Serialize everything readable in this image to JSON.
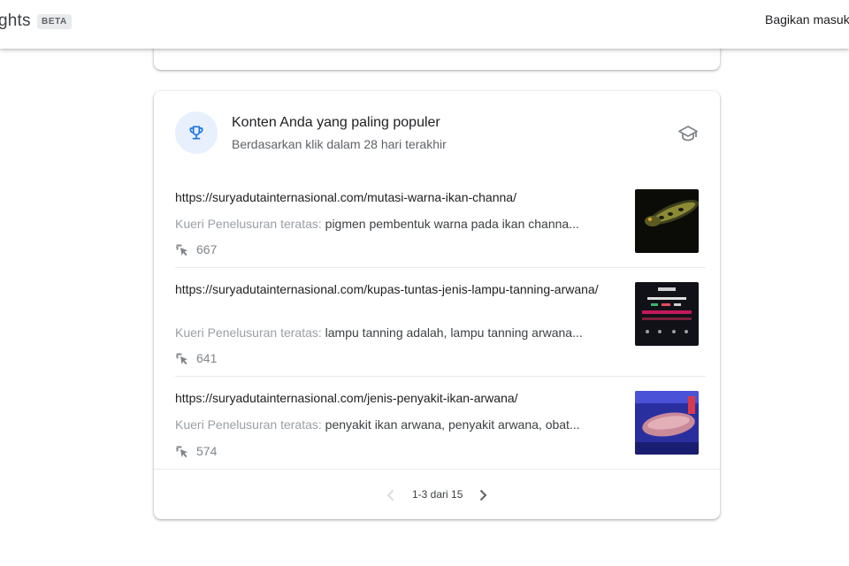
{
  "header": {
    "app_title": "ghts",
    "beta_label": "BETA",
    "feedback_label": "Bagikan masuk"
  },
  "popular_card": {
    "title": "Konten Anda yang paling populer",
    "subtitle": "Berdasarkan klik dalam 28 hari terakhir",
    "icons": {
      "header": "trophy-icon",
      "learn": "school-icon",
      "clicks": "click-icon"
    },
    "items": [
      {
        "url": "https://suryadutainternasional.com/mutasi-warna-ikan-channa/",
        "query_label": "Kueri Penelusuran teratas:",
        "query_value": "pigmen pembentuk warna pada ikan channa...",
        "clicks": "667"
      },
      {
        "url": "https://suryadutainternasional.com/kupas-tuntas-jenis-lampu-tanning-arwana/",
        "query_label": "Kueri Penelusuran teratas:",
        "query_value": "lampu tanning adalah, lampu tanning arwana...",
        "clicks": "641"
      },
      {
        "url": "https://suryadutainternasional.com/jenis-penyakit-ikan-arwana/",
        "query_label": "Kueri Penelusuran teratas:",
        "query_value": "penyakit ikan arwana, penyakit arwana, obat...",
        "clicks": "574"
      }
    ],
    "pagination": {
      "label": "1-3 dari 15"
    }
  },
  "colors": {
    "accent_blue": "#1a73e8",
    "icon_circle_bg": "#e8f0fe",
    "muted_text": "#9aa0a6",
    "divider": "#e8eaed"
  }
}
